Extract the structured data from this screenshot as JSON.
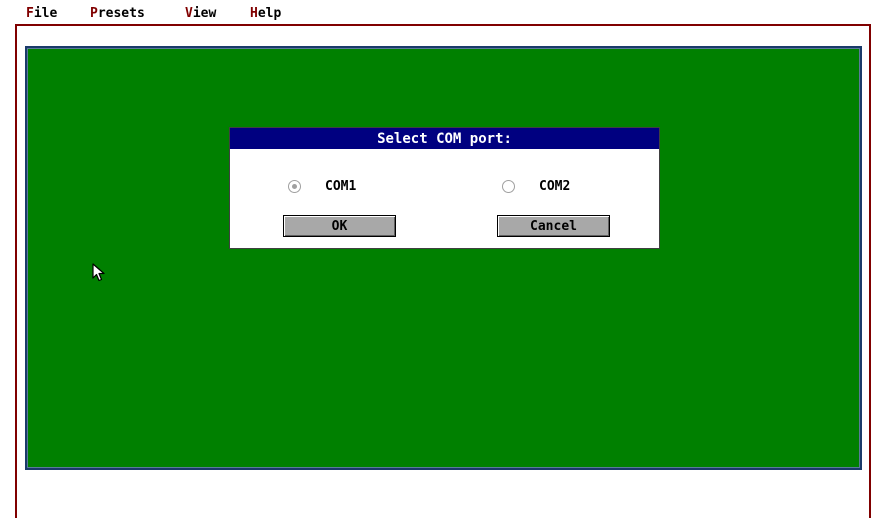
{
  "menubar": {
    "items": [
      {
        "hotkey": "F",
        "rest": "ile"
      },
      {
        "hotkey": "P",
        "rest": "resets"
      },
      {
        "hotkey": "V",
        "rest": "iew"
      },
      {
        "hotkey": "H",
        "rest": "elp"
      }
    ]
  },
  "colors": {
    "desktop": "#008000",
    "frame": "#800000",
    "title_bar": "#000080",
    "menu_hotkey": "#800000",
    "button_face": "#a8a8a8"
  },
  "dialog": {
    "title": "Select COM port:",
    "options": [
      {
        "label": "COM1",
        "selected": true
      },
      {
        "label": "COM2",
        "selected": false
      }
    ],
    "ok_label": "OK",
    "cancel_label": "Cancel"
  },
  "cursor": {
    "icon": "mouse-pointer-icon"
  }
}
